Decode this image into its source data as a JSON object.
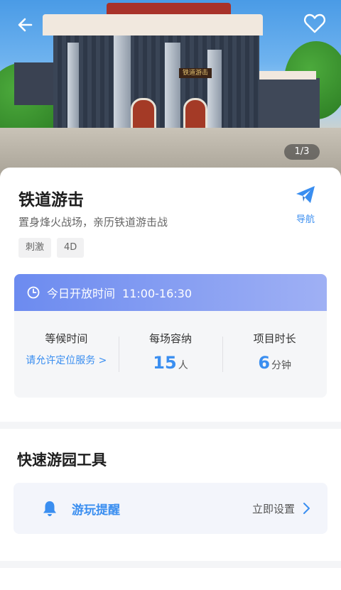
{
  "hero": {
    "sign_text": "铁道游击",
    "counter": "1/3"
  },
  "icons": {
    "back": "arrow-left-icon",
    "favorite": "heart-icon",
    "navigate": "paper-plane-icon",
    "clock": "clock-icon",
    "bell": "bell-icon",
    "chevron": "chevron-right-icon"
  },
  "attraction": {
    "title": "铁道游击",
    "subtitle": "置身烽火战场，亲历铁道游击战",
    "nav_label": "导航",
    "tags": [
      "刺激",
      "4D"
    ]
  },
  "hours": {
    "label": "今日开放时间",
    "value": "11:00-16:30"
  },
  "stats": {
    "wait": {
      "label": "等候时间",
      "link": "请允许定位服务 >"
    },
    "capacity": {
      "label": "每场容纳",
      "value": "15",
      "unit": "人"
    },
    "duration": {
      "label": "项目时长",
      "value": "6",
      "unit": "分钟"
    }
  },
  "tools": {
    "title": "快速游园工具",
    "reminder": {
      "name": "游玩提醒",
      "action": "立即设置"
    }
  },
  "colors": {
    "accent": "#3a8ef0",
    "header_gradient_start": "#6c8bf0",
    "header_gradient_end": "#9fb0f4"
  }
}
